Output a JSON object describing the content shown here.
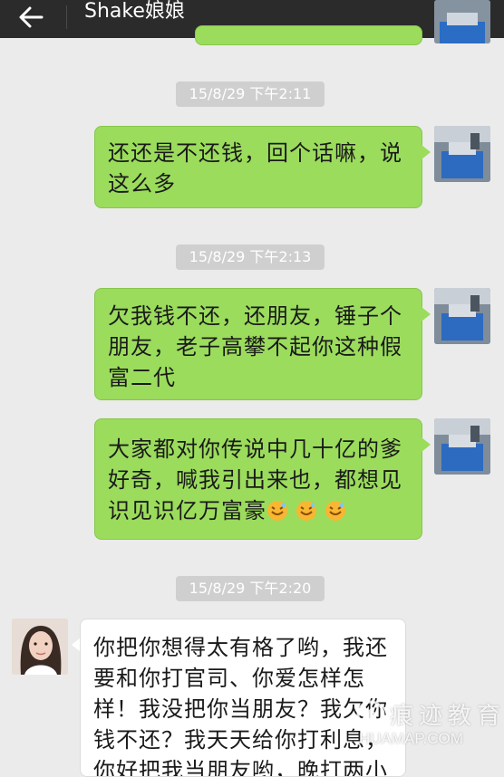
{
  "header": {
    "title": "Shake娘娘",
    "back_icon": "arrow-left-icon",
    "profile_icon": "person-icon"
  },
  "timestamps": [
    "15/8/29 下午2:11",
    "15/8/29 下午2:13",
    "15/8/29 下午2:20"
  ],
  "messages": [
    {
      "side": "out",
      "lines": [
        "还还是不还钱，回个话嘛，说",
        "这么多"
      ]
    },
    {
      "side": "out",
      "lines": [
        "欠我钱不还，还朋友，锤子个",
        "朋友，老子高攀不起你这种假",
        "富二代"
      ]
    },
    {
      "side": "out",
      "lines": [
        "大家都对你传说中几十亿的爹",
        "好奇，喊我引出来也，都想见",
        "识见识亿万富豪"
      ],
      "emoji": "sweat-smile-emoji"
    },
    {
      "side": "in",
      "lines": [
        "你把你想得太有格了哟，我还",
        "要和你打官司、你爱怎样怎",
        "样！我没把你当朋友？我欠你",
        "钱不还？我天天给你打利息，",
        "你好把我当朋友哟，晚打两小"
      ]
    }
  ],
  "watermark": {
    "text": "痕迹教育",
    "domain": "HUAMAP.COM"
  },
  "colors": {
    "header_bg": "#2b2b2b",
    "chat_bg": "#ebebeb",
    "outgoing_bubble": "#9bdc5c",
    "incoming_bubble": "#ffffff",
    "timestamp_bg": "#cfcfcf"
  }
}
